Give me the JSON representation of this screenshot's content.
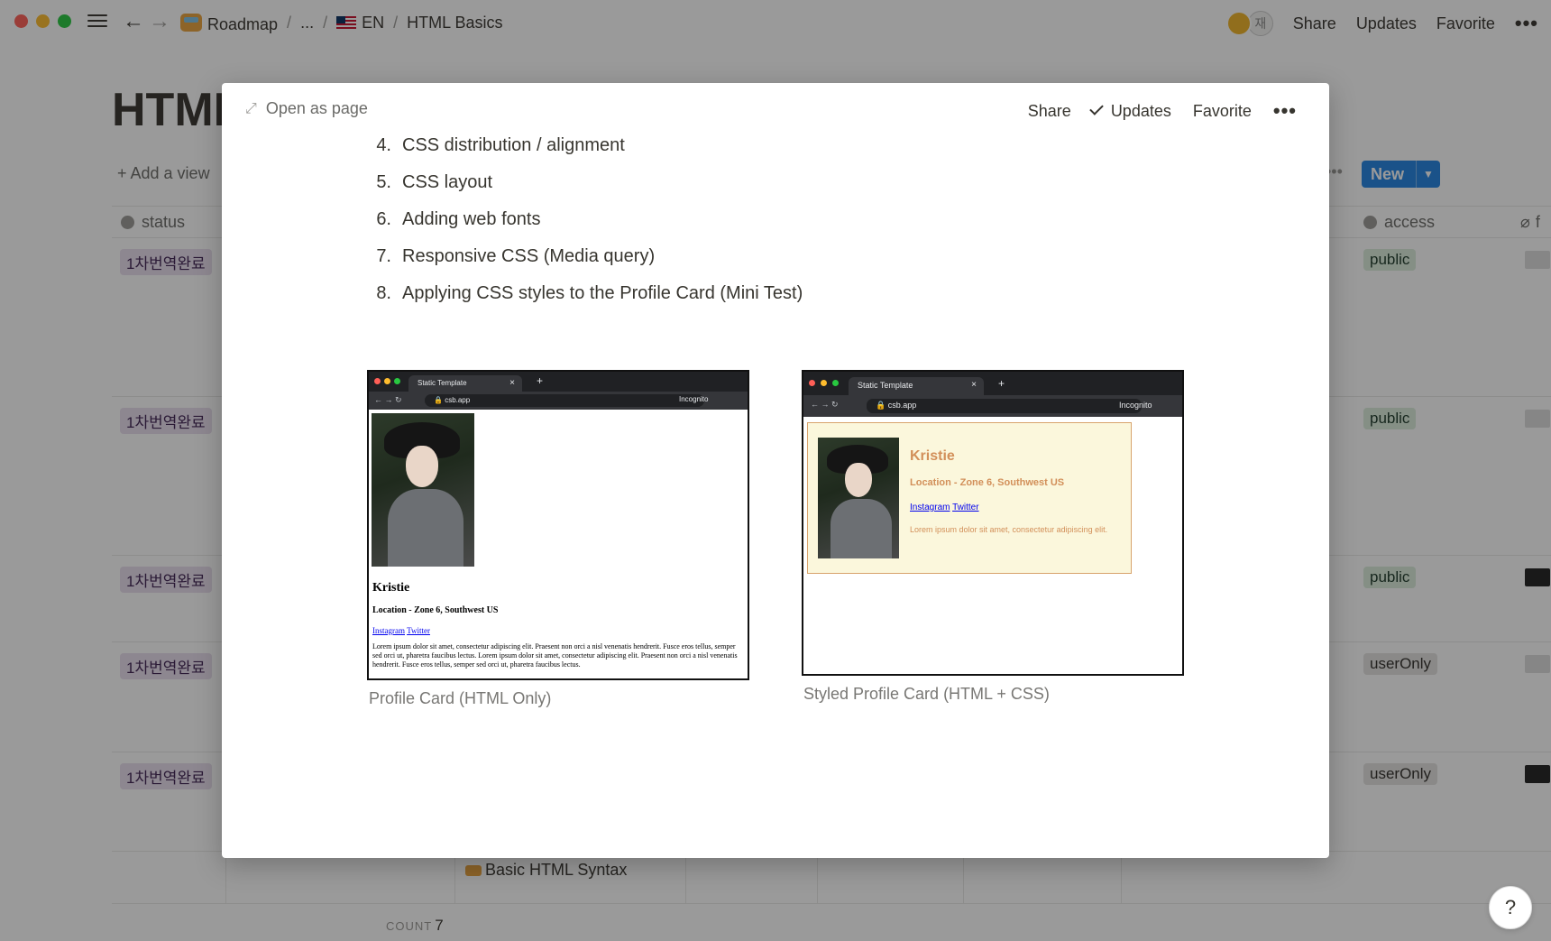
{
  "topbar": {
    "crumbs": [
      "Roadmap",
      "...",
      "EN",
      "HTML Basics"
    ],
    "avatar2_text": "재",
    "share": "Share",
    "updates": "Updates",
    "favorite": "Favorite",
    "more": "•••"
  },
  "page": {
    "title": "HTML",
    "add_view": "+ Add a view",
    "new_button": "New",
    "more_dots": "•••",
    "columns": {
      "status": "status",
      "access": "access",
      "f": "f"
    },
    "rows": [
      {
        "status": "1차번역완료",
        "access": "public"
      },
      {
        "status": "1차번역완료",
        "access": "public"
      },
      {
        "status": "1차번역완료",
        "access": "public"
      },
      {
        "status": "1차번역완료",
        "access": "userOnly"
      },
      {
        "status": "1차번역완료",
        "access": "userOnly"
      }
    ],
    "basic_row_text": "Basic HTML Syntax",
    "count_label": "COUNT",
    "count_value": "7",
    "help": "?"
  },
  "modal": {
    "open_as_page": "Open as page",
    "share": "Share",
    "updates": "Updates",
    "favorite": "Favorite",
    "more": "•••",
    "list": [
      {
        "num": "4.",
        "text": "CSS distribution / alignment"
      },
      {
        "num": "5.",
        "text": "CSS layout"
      },
      {
        "num": "6.",
        "text": "Adding web fonts"
      },
      {
        "num": "7.",
        "text": "Responsive CSS (Media query)"
      },
      {
        "num": "8.",
        "text": "Applying CSS styles to the Profile Card (Mini Test)"
      }
    ],
    "figure1": {
      "tab_title": "Static Template",
      "url": "csb.app",
      "incognito": "Incognito",
      "name": "Kristie",
      "location": "Location - Zone 6, Southwest US",
      "links": [
        "Instagram",
        "Twitter"
      ],
      "bio": "Lorem ipsum dolor sit amet, consectetur adipiscing elit. Praesent non orci a nisl venenatis hendrerit. Fusce eros tellus, semper sed orci ut, pharetra faucibus lectus. Lorem ipsum dolor sit amet, consectetur adipiscing elit. Praesent non orci a nisl venenatis hendrerit. Fusce eros tellus, semper sed orci ut, pharetra faucibus lectus.",
      "caption": "Profile Card (HTML Only)"
    },
    "figure2": {
      "tab_title": "Static Template",
      "url": "csb.app",
      "incognito": "Incognito",
      "name": "Kristie",
      "location": "Location - Zone 6, Southwest US",
      "links": [
        "Instagram",
        "Twitter"
      ],
      "bio": "Lorem ipsum dolor sit amet, consectetur adipiscing elit.",
      "caption": "Styled Profile Card (HTML + CSS)"
    }
  },
  "colors": {
    "accent_blue": "#2383e2",
    "tag_purple": "#e8deee",
    "tag_green": "#dbeddb",
    "tag_gray": "#e3e2e0",
    "card_bg": "#fbf7dc",
    "card_text": "#d28f59"
  }
}
